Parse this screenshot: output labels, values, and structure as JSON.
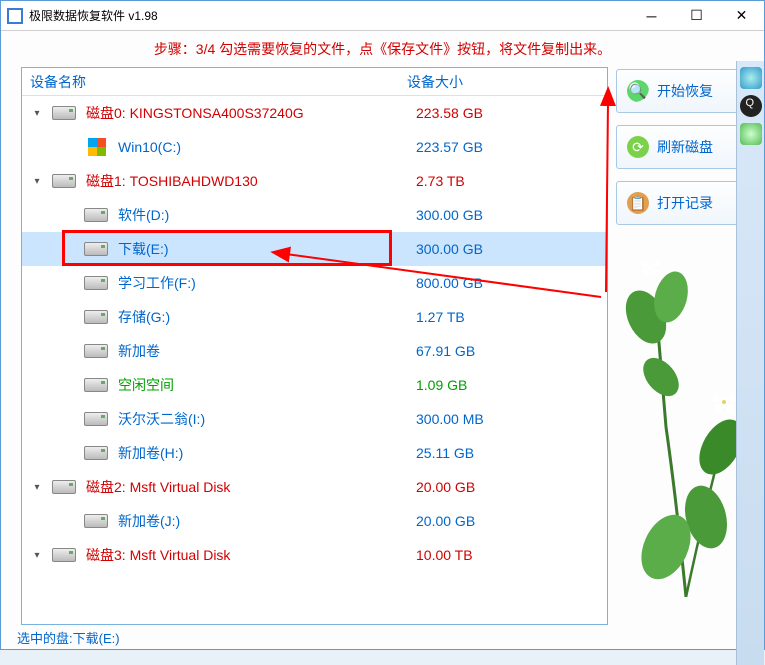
{
  "window": {
    "title": "极限数据恢复软件 v1.98"
  },
  "step_text": "步骤：3/4 勾选需要恢复的文件，点《保存文件》按钮，将文件复制出来。",
  "columns": {
    "name": "设备名称",
    "size": "设备大小"
  },
  "tree": [
    {
      "id": "d0",
      "indent": 0,
      "expander": "▾",
      "icon": "drive",
      "label": "磁盘0: KINGSTONSA400S37240G",
      "size": "223.58 GB",
      "cls": "red"
    },
    {
      "id": "d0p0",
      "indent": 1,
      "expander": "",
      "icon": "win",
      "label": "Win10(C:)",
      "size": "223.57 GB",
      "cls": "blue"
    },
    {
      "id": "d1",
      "indent": 0,
      "expander": "▾",
      "icon": "drive",
      "label": "磁盘1: TOSHIBAHDWD130",
      "size": "2.73 TB",
      "cls": "red"
    },
    {
      "id": "d1p0",
      "indent": 1,
      "expander": "",
      "icon": "drive",
      "label": "软件(D:)",
      "size": "300.00 GB",
      "cls": "blue"
    },
    {
      "id": "d1p1",
      "indent": 1,
      "expander": "",
      "icon": "drive",
      "label": "下载(E:)",
      "size": "300.00 GB",
      "cls": "blue",
      "selected": true,
      "highlight": true
    },
    {
      "id": "d1p2",
      "indent": 1,
      "expander": "",
      "icon": "drive",
      "label": "学习工作(F:)",
      "size": "800.00 GB",
      "cls": "blue"
    },
    {
      "id": "d1p3",
      "indent": 1,
      "expander": "",
      "icon": "drive",
      "label": "存储(G:)",
      "size": "1.27 TB",
      "cls": "blue"
    },
    {
      "id": "d1p4",
      "indent": 1,
      "expander": "",
      "icon": "drive",
      "label": "新加卷",
      "size": "67.91 GB",
      "cls": "blue"
    },
    {
      "id": "d1p5",
      "indent": 1,
      "expander": "",
      "icon": "drive",
      "label": "空闲空间",
      "size": "1.09 GB",
      "cls": "green"
    },
    {
      "id": "d1p6",
      "indent": 1,
      "expander": "",
      "icon": "drive",
      "label": "沃尔沃二翁(I:)",
      "size": "300.00 MB",
      "cls": "blue"
    },
    {
      "id": "d1p7",
      "indent": 1,
      "expander": "",
      "icon": "drive",
      "label": "新加卷(H:)",
      "size": "25.11 GB",
      "cls": "blue"
    },
    {
      "id": "d2",
      "indent": 0,
      "expander": "▾",
      "icon": "drive",
      "label": "磁盘2: Msft     Virtual Disk",
      "size": "20.00 GB",
      "cls": "red"
    },
    {
      "id": "d2p0",
      "indent": 1,
      "expander": "",
      "icon": "drive",
      "label": "新加卷(J:)",
      "size": "20.00 GB",
      "cls": "blue"
    },
    {
      "id": "d3",
      "indent": 0,
      "expander": "▾",
      "icon": "drive",
      "label": "磁盘3: Msft     Virtual Disk",
      "size": "10.00 TB",
      "cls": "red"
    }
  ],
  "side_buttons": {
    "start": "开始恢复",
    "refresh": "刷新磁盘",
    "open_log": "打开记录"
  },
  "status": "选中的盘:下载(E:)"
}
